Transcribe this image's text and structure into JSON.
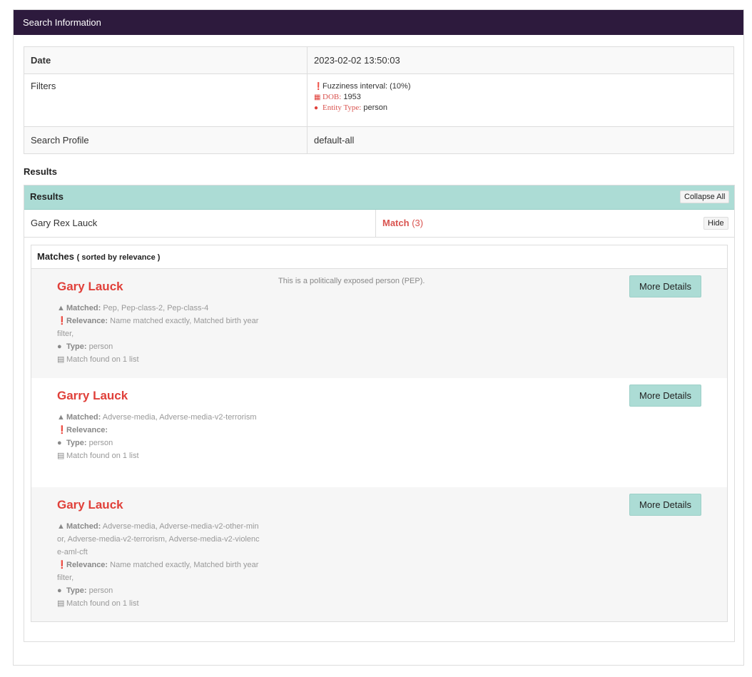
{
  "panel": {
    "title": "Search Information"
  },
  "info": {
    "date_label": "Date",
    "date_value": "2023-02-02 13:50:03",
    "filters_label": "Filters",
    "filters": {
      "fuzziness": "Fuzziness interval: (10%)",
      "dob_label": "DOB:",
      "dob_value": "1953",
      "entity_label": "Entity Type:",
      "entity_value": "person"
    },
    "profile_label": "Search Profile",
    "profile_value": "default-all"
  },
  "results": {
    "section_title": "Results",
    "panel_title": "Results",
    "collapse_label": "Collapse All",
    "person_name": "Gary Rex Lauck",
    "match_label": "Match",
    "match_count": "(3)",
    "hide_label": "Hide",
    "matches_title": "Matches",
    "matches_sub": "( sorted by relevance )",
    "items": [
      {
        "name": "Gary Lauck",
        "desc": "This is a politically exposed person (PEP).",
        "matched_label": "Matched:",
        "matched": "Pep, Pep-class-2, Pep-class-4",
        "relevance_label": "Relevance:",
        "relevance": "Name matched exactly, Matched birth year filter,",
        "type_label": "Type:",
        "type": "person",
        "lists": "Match found on 1 list",
        "button": "More Details"
      },
      {
        "name": "Garry Lauck",
        "desc": "",
        "matched_label": "Matched:",
        "matched": "Adverse-media, Adverse-media-v2-terrorism",
        "relevance_label": "Relevance:",
        "relevance": "",
        "type_label": "Type:",
        "type": "person",
        "lists": "Match found on 1 list",
        "button": "More Details"
      },
      {
        "name": "Gary Lauck",
        "desc": "",
        "matched_label": "Matched:",
        "matched": "Adverse-media, Adverse-media-v2-other-minor, Adverse-media-v2-terrorism, Adverse-media-v2-violence-aml-cft",
        "relevance_label": "Relevance:",
        "relevance": "Name matched exactly, Matched birth year filter,",
        "type_label": "Type:",
        "type": "person",
        "lists": "Match found on 1 list",
        "button": "More Details"
      }
    ]
  },
  "icons": {
    "info": "info-circle-icon",
    "calendar": "calendar-icon",
    "user": "user-icon",
    "warning": "warning-icon",
    "list": "list-icon"
  },
  "colors": {
    "header_bg": "#2d1a3d",
    "accent_teal": "#acdcd5",
    "match_red": "#e0403a"
  }
}
